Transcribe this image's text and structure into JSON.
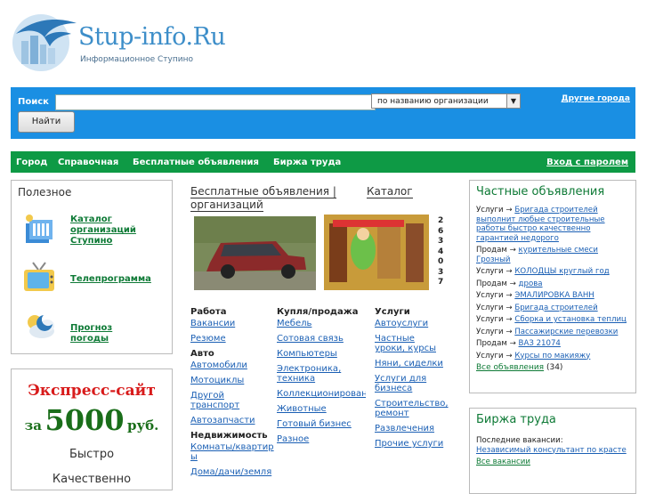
{
  "header": {
    "site_name": "Stup-info.Ru",
    "tagline": "Информационное Ступино"
  },
  "search": {
    "label": "Поиск",
    "value": "",
    "placeholder": "",
    "mode_selected": "по названию организации",
    "submit_label": "Найти",
    "other_cities": "Другие города"
  },
  "nav": {
    "items": [
      "Город",
      "Справочная",
      "Бесплатные объявления",
      "Биржа труда"
    ],
    "login": "Вход с паролем"
  },
  "useful": {
    "title": "Полезное",
    "items": [
      {
        "label": "Каталог организаций Ступино",
        "icon": "catalog-icon"
      },
      {
        "label": "Телепрограмма",
        "icon": "tv-icon"
      },
      {
        "label": "Прогноз погоды",
        "icon": "weather-icon"
      }
    ]
  },
  "express": {
    "line1": "Экспресс-сайт",
    "prefix": "за",
    "price": "5000",
    "currency": "руб.",
    "line3": "Быстро",
    "line4": "Качественно"
  },
  "middle": {
    "tab_ads": "Бесплатные объявления | организаций",
    "tab_catalog": "Каталог",
    "banner_phone_digits": "2 6 3 4 0 3 7",
    "columns": [
      {
        "sections": [
          {
            "heading": "Работа",
            "links": [
              "Вакансии",
              "Резюме"
            ]
          },
          {
            "heading": "Авто",
            "links": [
              "Автомобили",
              "Мотоциклы",
              "Другой транспорт",
              "Автозапчасти"
            ]
          },
          {
            "heading": "Недвижимость",
            "links": [
              "Комнаты/квартиры",
              "Дома/дачи/земля"
            ]
          }
        ]
      },
      {
        "sections": [
          {
            "heading": "Купля/продажа",
            "links": [
              "Мебель",
              "Сотовая связь",
              "Компьютеры",
              "Электроника, техника",
              "Коллекционирование",
              "Животные",
              "Готовый бизнес",
              "Разное"
            ]
          }
        ]
      },
      {
        "sections": [
          {
            "heading": "Услуги",
            "links": [
              "Автоуслуги",
              "Частные уроки, курсы",
              "Няни, сиделки",
              "Услуги для бизнеса",
              "Строительство, ремонт",
              "Развлечения",
              "Прочие услуги"
            ]
          }
        ]
      }
    ]
  },
  "private_ads": {
    "title": "Частные объявления",
    "arrow": "→",
    "rows": [
      {
        "type": "Услуги",
        "text": "Бригада строителей выполнит любые строительные работы быстро качественно гарантией недорого"
      },
      {
        "type": "Продам",
        "text": "курительные смеси Грозный"
      },
      {
        "type": "Услуги",
        "text": "КОЛОДЦЫ круглый год"
      },
      {
        "type": "Продам",
        "text": "дрова"
      },
      {
        "type": "Услуги",
        "text": "ЭМАЛИРОВКА ВАНН"
      },
      {
        "type": "Услуги",
        "text": "Бригада строителей"
      },
      {
        "type": "Услуги",
        "text": "Сборка и установка теплиц"
      },
      {
        "type": "Услуги",
        "text": "Пассажирские перевозки"
      },
      {
        "type": "Продам",
        "text": "ВАЗ 21074"
      },
      {
        "type": "Услуги",
        "text": "Курсы по макияжу"
      }
    ],
    "all_label": "Все объявления",
    "all_count": "(34)"
  },
  "jobs": {
    "title": "Биржа труда",
    "subtitle": "Последние вакансии:",
    "latest": "Независимый консультант по красте",
    "all_label": "Все вакансии"
  },
  "colors": {
    "search_bar": "#1a8fe3",
    "nav_bar": "#0e9a45",
    "link": "#1a5fb4",
    "express_red": "#d81b1b",
    "express_green": "#1a6e1a"
  }
}
